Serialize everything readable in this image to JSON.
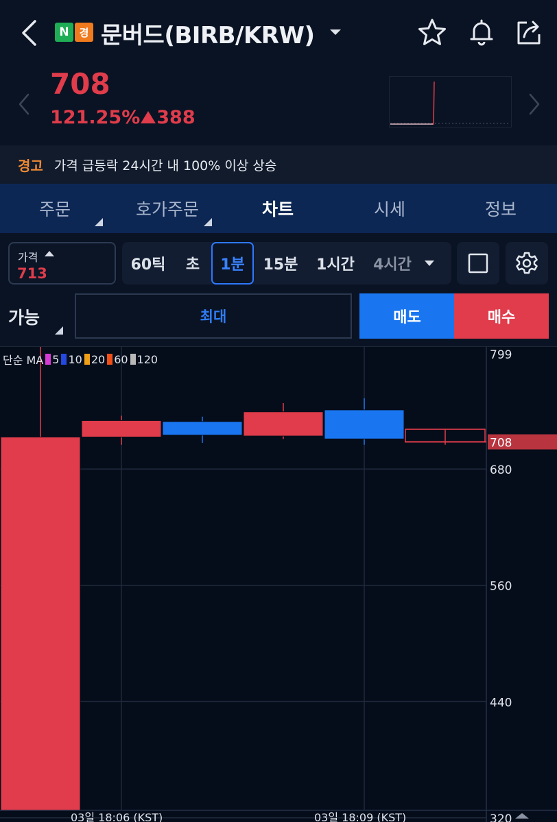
{
  "header": {
    "badge_n": "N",
    "badge_k": "경",
    "title": "문버드(BIRB/KRW)"
  },
  "summary": {
    "price": "708",
    "change_pct": "121.25%",
    "change_abs": "388",
    "color_up": "#e03c4b"
  },
  "warning": {
    "label": "경고",
    "text": "가격 급등락 24시간 내 100% 이상 상승"
  },
  "tabs": [
    {
      "label": "주문"
    },
    {
      "label": "호가주문"
    },
    {
      "label": "차트"
    },
    {
      "label": "시세"
    },
    {
      "label": "정보"
    }
  ],
  "toolbar": {
    "price_label": "가격",
    "price_value": "713",
    "intervals": [
      {
        "label": "60틱"
      },
      {
        "label": "초"
      },
      {
        "label": "1분"
      },
      {
        "label": "15분"
      },
      {
        "label": "1시간"
      },
      {
        "label": "4시간"
      }
    ]
  },
  "order": {
    "avail_label": "가능",
    "max_label": "최대",
    "sell_label": "매도",
    "buy_label": "매수",
    "sell_color": "#1976f0",
    "buy_color": "#e03c4b"
  },
  "chart_data": {
    "type": "candlestick",
    "ma_legend": {
      "prefix": "단순 MA",
      "items": [
        {
          "label": "5",
          "color": "#d63bd6"
        },
        {
          "label": "10",
          "color": "#2448e0"
        },
        {
          "label": "20",
          "color": "#f0a018"
        },
        {
          "label": "60",
          "color": "#f05018"
        },
        {
          "label": "120",
          "color": "#b8b8b8"
        }
      ]
    },
    "y_ticks": [
      799,
      680,
      560,
      440,
      320
    ],
    "ylim": [
      315,
      806
    ],
    "current_price": 708,
    "current_price_label": "708",
    "x_labels": [
      "03일 18:06 (KST)",
      "03일 18:09 (KST)"
    ],
    "candles": [
      {
        "open": 320,
        "close": 713,
        "high": 829,
        "low": 310,
        "up": true
      },
      {
        "open": 713,
        "close": 730,
        "high": 735,
        "low": 705,
        "up": true
      },
      {
        "open": 729,
        "close": 715,
        "high": 734,
        "low": 707,
        "up": false
      },
      {
        "open": 714,
        "close": 739,
        "high": 748,
        "low": 711,
        "up": true
      },
      {
        "open": 741,
        "close": 711,
        "high": 753,
        "low": 705,
        "up": false
      },
      {
        "open": 721,
        "close": 708,
        "high": 721,
        "low": 705,
        "up": true
      }
    ]
  }
}
